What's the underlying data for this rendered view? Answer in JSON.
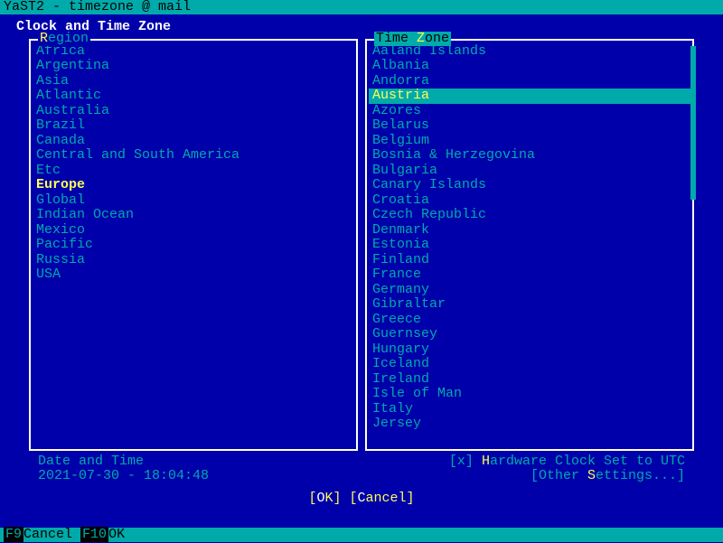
{
  "titlebar": "YaST2 - timezone @ mail",
  "heading": "Clock and Time Zone",
  "region": {
    "label_pre": "R",
    "label_rest": "egion",
    "selected": "Europe",
    "items": [
      "Africa",
      "Argentina",
      "Asia",
      "Atlantic",
      "Australia",
      "Brazil",
      "Canada",
      "Central and South America",
      "Etc",
      "Europe",
      "Global",
      "Indian Ocean",
      "Mexico",
      "Pacific",
      "Russia",
      "USA"
    ]
  },
  "timezone": {
    "label_pre": "Time ",
    "label_accel": "Z",
    "label_rest": "one",
    "selected": "Austria",
    "items": [
      "Aaland Islands",
      "Albania",
      "Andorra",
      "Austria",
      "Azores",
      "Belarus",
      "Belgium",
      "Bosnia & Herzegovina",
      "Bulgaria",
      "Canary Islands",
      "Croatia",
      "Czech Republic",
      "Denmark",
      "Estonia",
      "Finland",
      "France",
      "Germany",
      "Gibraltar",
      "Greece",
      "Guernsey",
      "Hungary",
      "Iceland",
      "Ireland",
      "Isle of Man",
      "Italy",
      "Jersey"
    ]
  },
  "datetime": {
    "label": "Date and Time",
    "value": "2021-07-30 - 18:04:48"
  },
  "hwclock": {
    "checked": "x",
    "pre": "] ",
    "accel": "H",
    "rest": "ardware Clock Set to UTC"
  },
  "other_settings": {
    "open": "[Other ",
    "accel": "S",
    "rest": "ettings...]"
  },
  "buttons": {
    "ok_open": "[",
    "ok_accel": "O",
    "ok_rest": "K]",
    "cancel_open": "[",
    "cancel_accel": "C",
    "cancel_rest": "ancel]"
  },
  "status": {
    "f9": "F9",
    "f9_label": "Cancel",
    "f10": "F10",
    "f10_label": "OK"
  }
}
